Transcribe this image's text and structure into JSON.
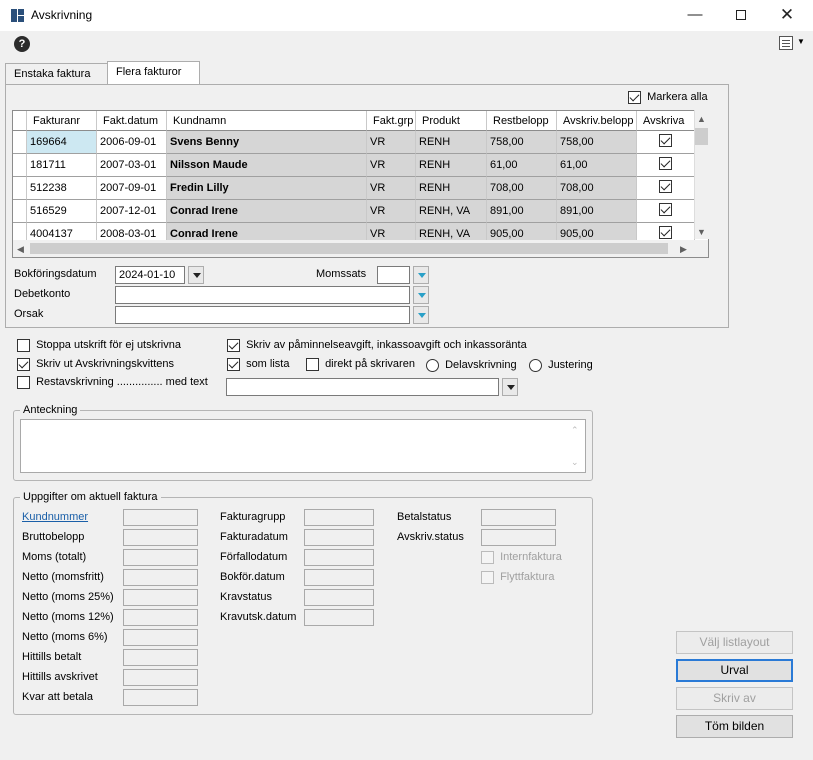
{
  "window": {
    "title": "Avskrivning"
  },
  "tabs": [
    {
      "label": "Enstaka faktura"
    },
    {
      "label": "Flera fakturor"
    }
  ],
  "markera_alla": {
    "label": "Markera alla",
    "checked": true
  },
  "grid": {
    "columns": [
      "Fakturanr",
      "Fakt.datum",
      "Kundnamn",
      "Fakt.grp",
      "Produkt",
      "Restbelopp",
      "Avskriv.belopp",
      "Avskriva"
    ],
    "rows": [
      {
        "fakturanr": "169664",
        "datum": "2006-09-01",
        "kund": "Svens Benny",
        "grp": "VR",
        "produkt": "RENH",
        "rest": "758,00",
        "avskriv": "758,00",
        "checked": true
      },
      {
        "fakturanr": "181711",
        "datum": "2007-03-01",
        "kund": "Nilsson Maude",
        "grp": "VR",
        "produkt": "RENH",
        "rest": "61,00",
        "avskriv": "61,00",
        "checked": true
      },
      {
        "fakturanr": "512238",
        "datum": "2007-09-01",
        "kund": "Fredin Lilly",
        "grp": "VR",
        "produkt": "RENH",
        "rest": "708,00",
        "avskriv": "708,00",
        "checked": true
      },
      {
        "fakturanr": "516529",
        "datum": "2007-12-01",
        "kund": "Conrad Irene",
        "grp": "VR",
        "produkt": "RENH, VA",
        "rest": "891,00",
        "avskriv": "891,00",
        "checked": true
      },
      {
        "fakturanr": "4004137",
        "datum": "2008-03-01",
        "kund": "Conrad Irene",
        "grp": "VR",
        "produkt": "RENH, VA",
        "rest": "905,00",
        "avskriv": "905,00",
        "checked": true
      }
    ]
  },
  "form": {
    "bokforingsdatum_label": "Bokföringsdatum",
    "bokforingsdatum_value": "2024-01-10",
    "momssats_label": "Momssats",
    "debetkonto_label": "Debetkonto",
    "orsak_label": "Orsak"
  },
  "options": {
    "stoppa": {
      "label": "Stoppa utskrift för ej utskrivna",
      "checked": false
    },
    "skriv_ut": {
      "label": "Skriv ut Avskrivningskvittens",
      "checked": true
    },
    "restavskrivning": {
      "label": "Restavskrivning ............... med text",
      "checked": false
    },
    "skriv_av_pamin": {
      "label": "Skriv av påminnelseavgift, inkassoavgift och inkassoränta",
      "checked": true
    },
    "som_lista": {
      "label": "som lista",
      "checked": true
    },
    "direkt": {
      "label": "direkt på skrivaren",
      "checked": false
    },
    "delavskrivning": {
      "label": "Delavskrivning"
    },
    "justering": {
      "label": "Justering"
    }
  },
  "anteckning": {
    "title": "Anteckning"
  },
  "uppgifter": {
    "title": "Uppgifter om aktuell faktura",
    "col1": [
      "Kundnummer",
      "Bruttobelopp",
      "Moms (totalt)",
      "Netto (momsfritt)",
      "Netto (moms 25%)",
      "Netto (moms 12%)",
      "Netto (moms 6%)",
      "Hittills betalt",
      "Hittills avskrivet",
      "Kvar att betala"
    ],
    "col2": [
      "Fakturagrupp",
      "Fakturadatum",
      "Förfallodatum",
      "Bokför.datum",
      "Kravstatus",
      "Kravutsk.datum"
    ],
    "col3": [
      "Betalstatus",
      "Avskriv.status"
    ],
    "internfaktura": "Internfaktura",
    "flyttfaktura": "Flyttfaktura"
  },
  "buttons": {
    "valj_listlayout": "Välj listlayout",
    "urval": "Urval",
    "skriv_av": "Skriv av",
    "tom_bilden": "Töm bilden"
  }
}
